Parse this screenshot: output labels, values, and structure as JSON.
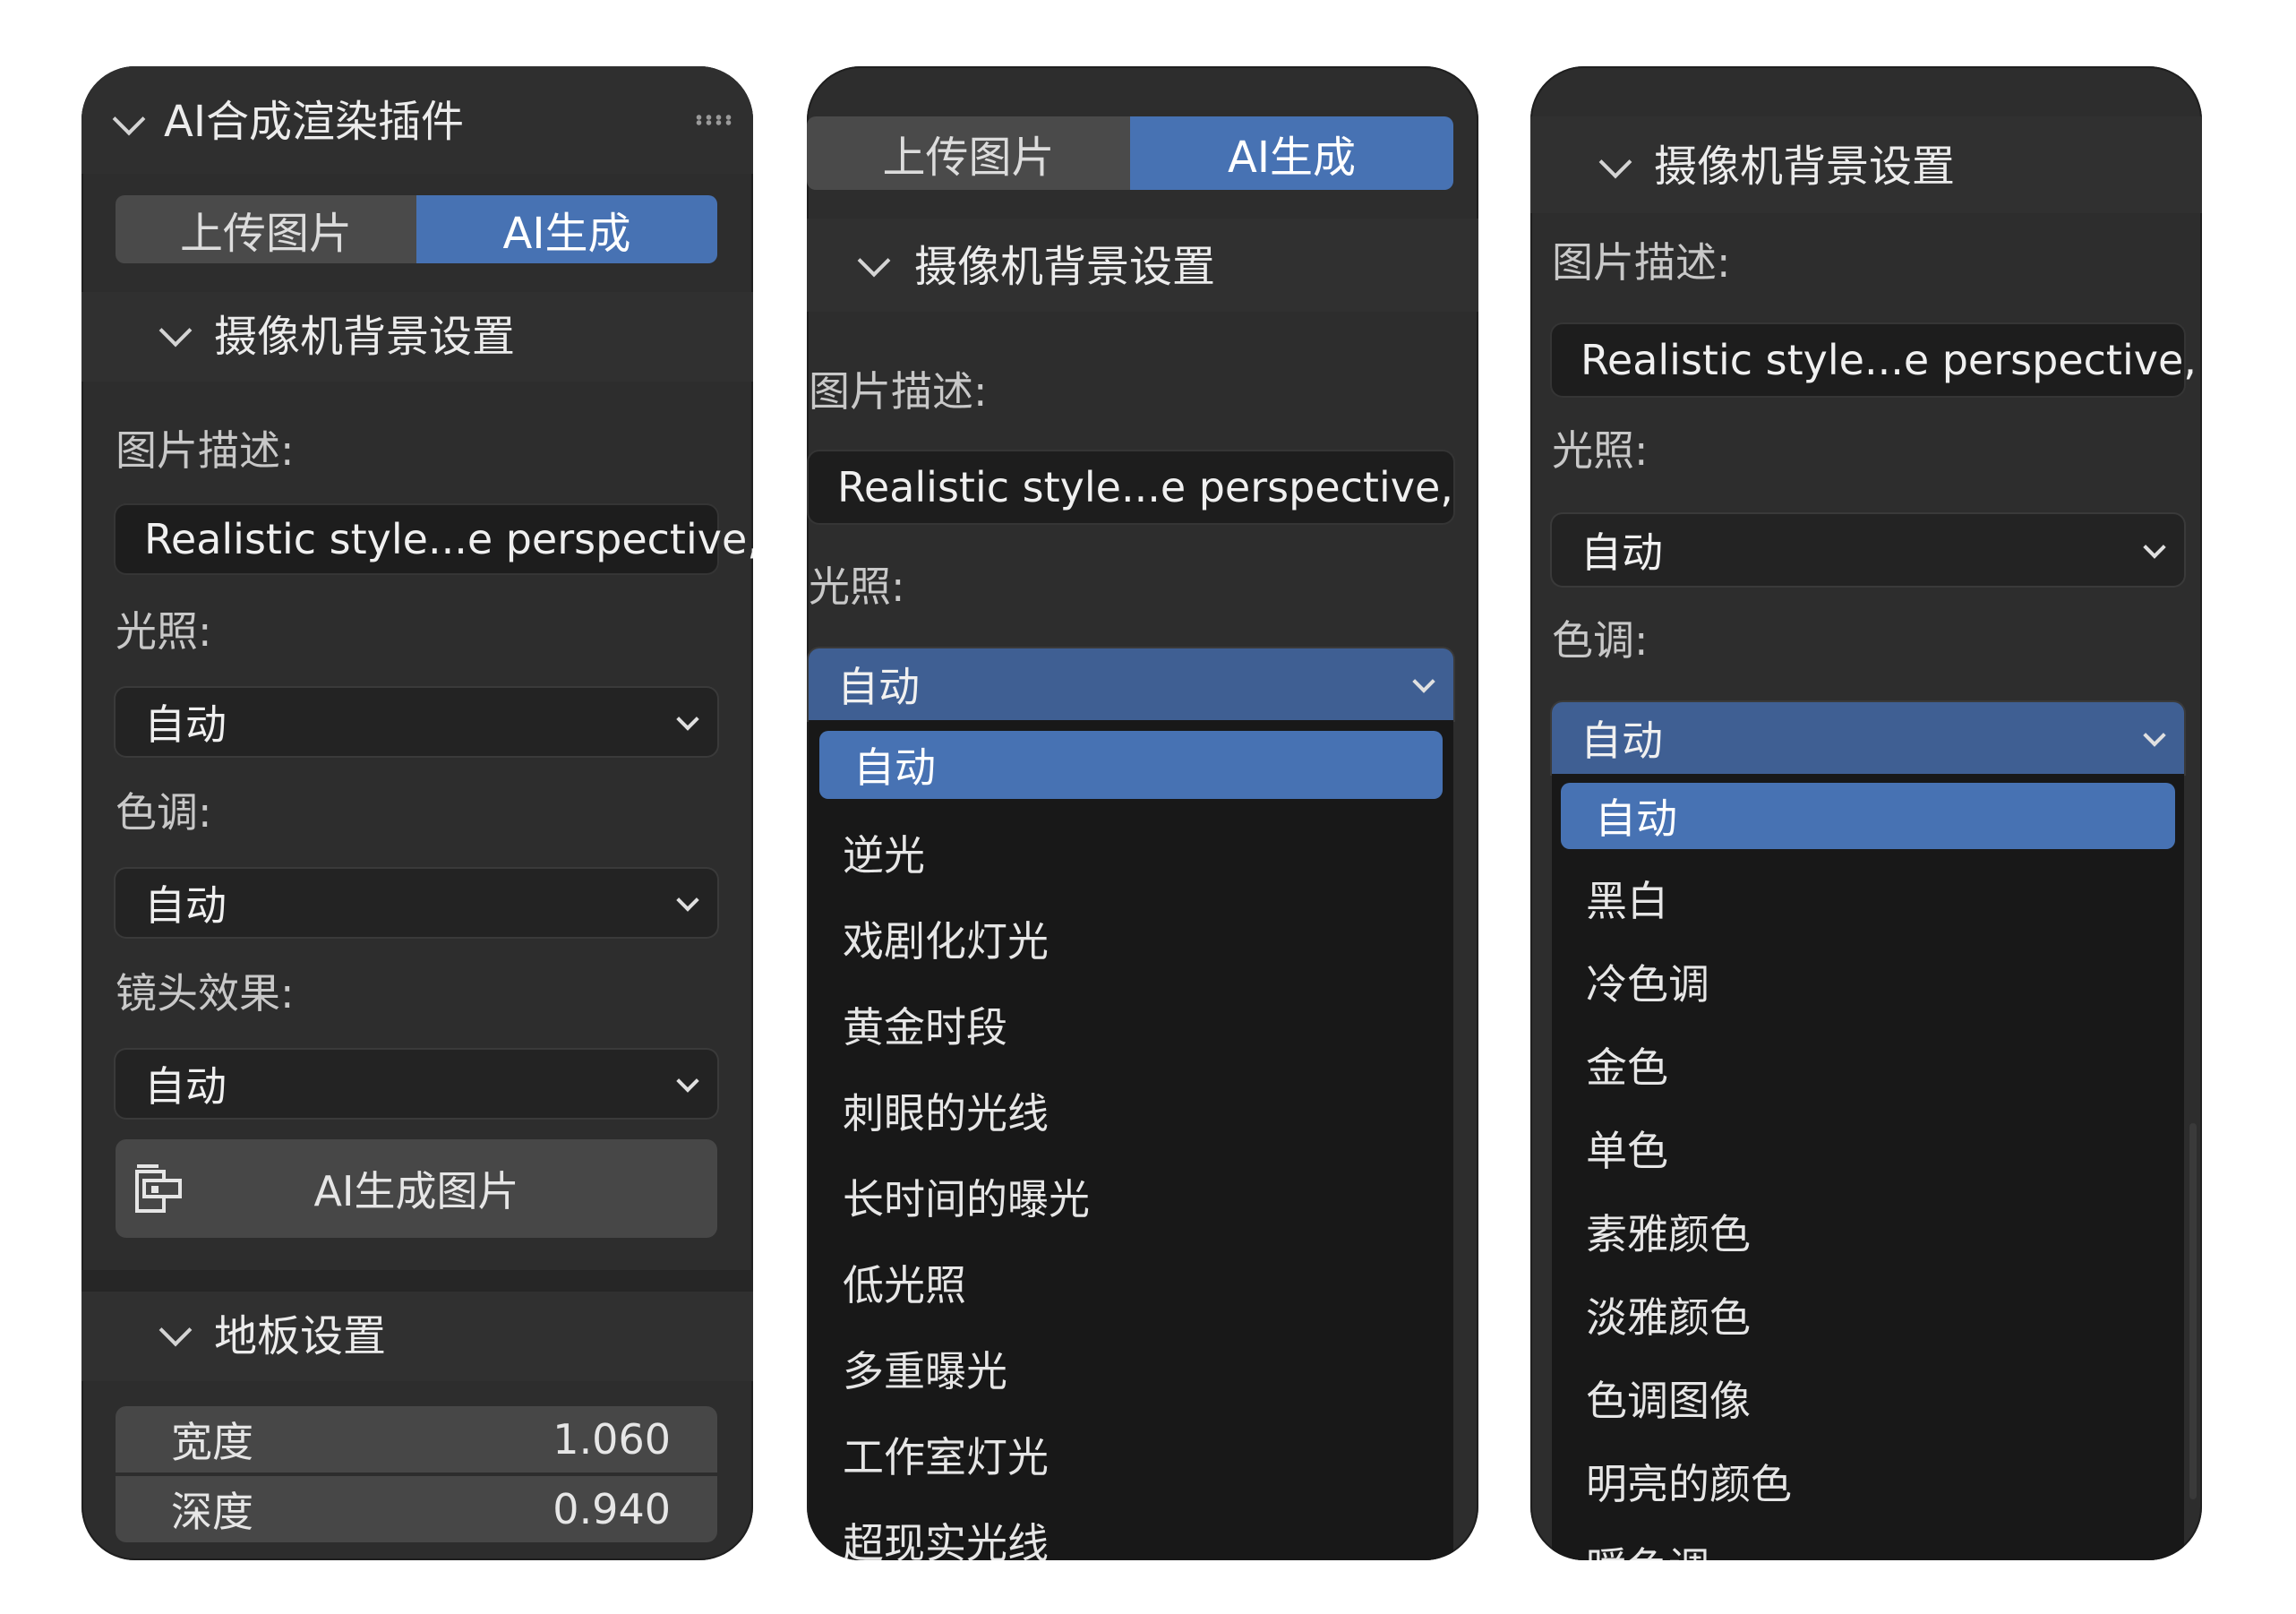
{
  "panel1": {
    "title": "AI合成渲染插件",
    "tabs": [
      {
        "label": "上传图片"
      },
      {
        "label": "AI生成"
      }
    ],
    "camera_section": "摄像机背景设置",
    "desc_label": "图片描述:",
    "desc_value": "Realistic style...e perspective,",
    "lighting_label": "光照:",
    "lighting_value": "自动",
    "tone_label": "色调:",
    "tone_value": "自动",
    "lens_label": "镜头效果:",
    "lens_value": "自动",
    "generate_button": "AI生成图片",
    "floor_section": "地板设置",
    "width_label": "宽度",
    "width_value": "1.060",
    "depth_label": "深度",
    "depth_value": "0.940"
  },
  "panel2": {
    "tabs": [
      {
        "label": "上传图片"
      },
      {
        "label": "AI生成"
      }
    ],
    "camera_section": "摄像机背景设置",
    "desc_label": "图片描述:",
    "desc_value": "Realistic style...e perspective,",
    "lighting_label": "光照:",
    "lighting_value": "自动",
    "lighting_options": [
      "自动",
      "逆光",
      "戏剧化灯光",
      "黄金时段",
      "刺眼的光线",
      "长时间的曝光",
      "低光照",
      "多重曝光",
      "工作室灯光",
      "超现实光线"
    ]
  },
  "panel3": {
    "camera_section": "摄像机背景设置",
    "desc_label": "图片描述:",
    "desc_value": "Realistic style...e perspective,",
    "lighting_label": "光照:",
    "lighting_value": "自动",
    "tone_label": "色调:",
    "tone_value": "自动",
    "tone_options": [
      "自动",
      "黑白",
      "冷色调",
      "金色",
      "单色",
      "素雅颜色",
      "淡雅颜色",
      "色调图像",
      "明亮的颜色",
      "暖色调"
    ]
  },
  "colors": {
    "accent": "#4772b3",
    "panel_bg": "#2d2d2d",
    "menu_bg": "#181818",
    "field_bg": "#1d1d1d",
    "button_bg": "#474747"
  },
  "icons": {
    "collapse": "chevron-down-icon",
    "dropdown": "chevron-down-icon",
    "drag": "grip-dots-icon",
    "generate": "image-generate-icon"
  }
}
